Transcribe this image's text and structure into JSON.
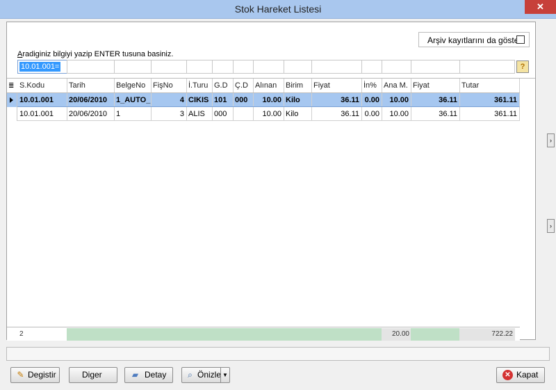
{
  "window": {
    "title": "Stok Hareket Listesi",
    "close_glyph": "✕"
  },
  "archive": {
    "label": "Arşiv kayıtlarını da göste",
    "checked": false
  },
  "search": {
    "label_underline": "A",
    "label_rest": "radiginiz bilgiyi yazip ENTER tusuna basiniz.",
    "value": "10.01.001="
  },
  "grid": {
    "columns": [
      "S.Kodu",
      "Tarih",
      "BelgeNo",
      "FişNo",
      "İ.Turu",
      "G.D",
      "Ç.D",
      "Alınan",
      "Birim",
      "Fiyat",
      "İn%",
      "Ana M.",
      "Fiyat",
      "Tutar"
    ],
    "rows": [
      [
        "10.01.001",
        "20/06/2010",
        "1_AUTO_",
        "4",
        "CIKIS",
        "101",
        "000",
        "10.00",
        "Kilo",
        "36.11",
        "0.00",
        "10.00",
        "36.11",
        "361.11"
      ],
      [
        "10.01.001",
        "20/06/2010",
        "1",
        "3",
        "ALIS",
        "000",
        "",
        "10.00",
        "Kilo",
        "36.11",
        "0.00",
        "10.00",
        "36.11",
        "361.11"
      ]
    ],
    "footer": {
      "count": "2",
      "ana_m_total": "20.00",
      "tutar_total": "722.22"
    }
  },
  "buttons": {
    "degistir": "Degistir",
    "diger": "Diger",
    "detay": "Detay",
    "onizle": "Önizle",
    "kapat": "Kapat"
  }
}
